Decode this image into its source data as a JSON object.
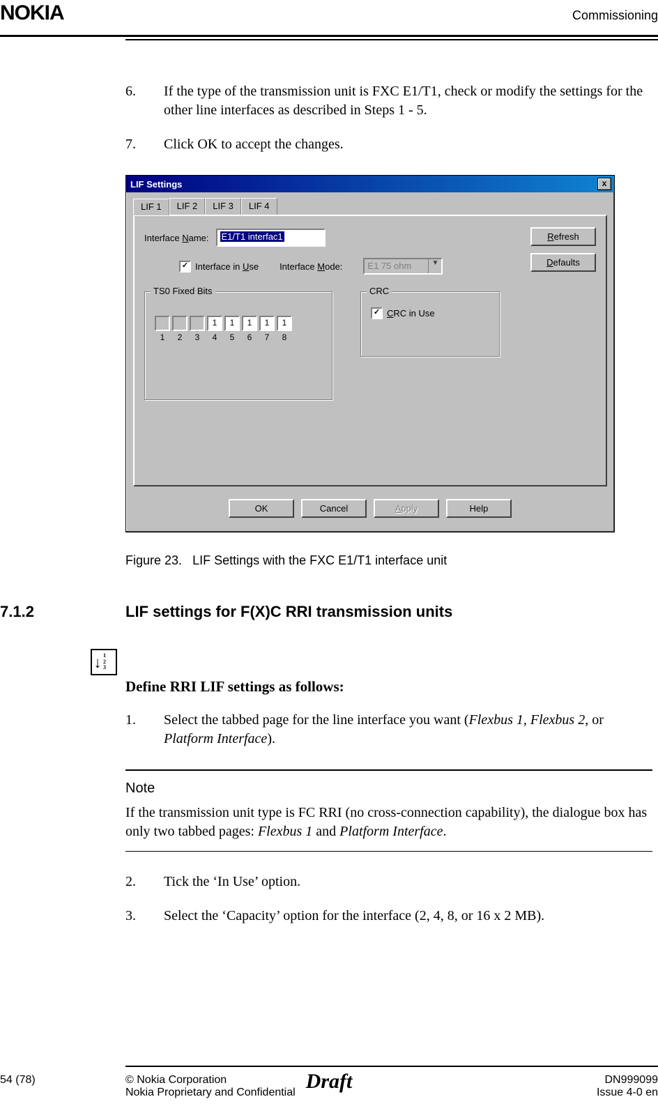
{
  "header": {
    "logo": "NOKIA",
    "section": "Commissioning"
  },
  "steps_top": [
    {
      "num": "6.",
      "text": "If the type of the transmission unit is FXC E1/T1, check or modify the settings for the other line interfaces as described in Steps 1 - 5."
    },
    {
      "num": "7.",
      "text": "Click OK to accept the changes."
    }
  ],
  "dialog": {
    "title": "LIF Settings",
    "close": "x",
    "tabs": [
      "LIF 1",
      "LIF 2",
      "LIF 3",
      "LIF 4"
    ],
    "active_tab": 0,
    "interface_name_label": "Interface Name:",
    "interface_name_value": "E1/T1 interfac1",
    "refresh": "Refresh",
    "defaults": "Defaults",
    "interface_in_use_label": "Interface in Use",
    "interface_in_use_checked": true,
    "interface_mode_label": "Interface Mode:",
    "interface_mode_value": "E1 75 ohm",
    "ts0_legend": "TS0 Fixed Bits",
    "ts0_values": [
      "",
      "",
      "",
      "1",
      "1",
      "1",
      "1",
      "1"
    ],
    "ts0_labels": [
      "1",
      "2",
      "3",
      "4",
      "5",
      "6",
      "7",
      "8"
    ],
    "crc_legend": "CRC",
    "crc_label": "CRC in Use",
    "crc_checked": true,
    "buttons": {
      "ok": "OK",
      "cancel": "Cancel",
      "apply": "Apply",
      "help": "Help"
    }
  },
  "figure_caption": {
    "label": "Figure 23.",
    "text": "LIF Settings with the FXC E1/T1 interface unit"
  },
  "section": {
    "num": "7.1.2",
    "title": "LIF settings for F(X)C RRI transmission units"
  },
  "icon_nums": [
    "1",
    "2",
    "3"
  ],
  "define_heading": "Define RRI LIF settings as follows:",
  "steps_bottom": [
    {
      "num": "1.",
      "pre": "Select the tabbed page for the line interface you want (",
      "em1": "Flexbus 1, Flexbus 2",
      "mid": ", or ",
      "em2": "Platform Interface",
      "post": ")."
    }
  ],
  "note": {
    "title": "Note",
    "pre": "If the transmission unit type is FC RRI (no cross-connection capability), the dialogue box has only two tabbed pages: ",
    "em1": "Flexbus 1",
    "mid": " and ",
    "em2": "Platform Interface",
    "post": "."
  },
  "steps_after_note": [
    {
      "num": "2.",
      "text": "Tick the ‘In Use’ option."
    },
    {
      "num": "3.",
      "text": "Select the ‘Capacity’ option for the interface (2, 4, 8, or 16 x 2 MB)."
    }
  ],
  "footer": {
    "page": "54 (78)",
    "copyright": "© Nokia Corporation",
    "confidential": "Nokia Proprietary and Confidential",
    "draft": "Draft",
    "doc": "DN999099",
    "issue": "Issue 4-0 en"
  }
}
